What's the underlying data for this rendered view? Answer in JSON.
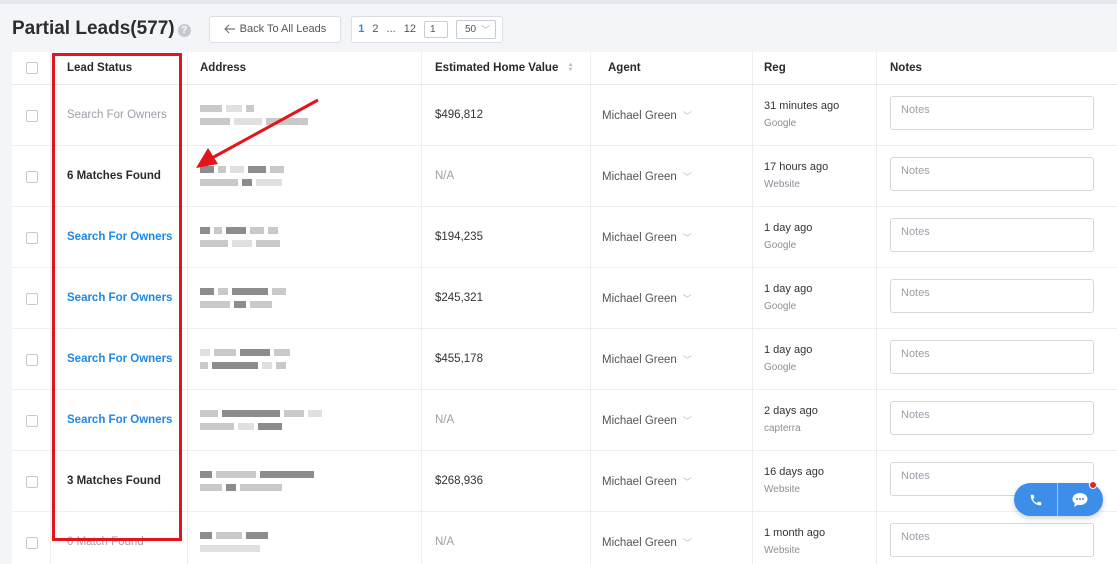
{
  "header": {
    "title": "Partial Leads(577)",
    "help_glyph": "?",
    "back_button": "Back To All Leads"
  },
  "pager": {
    "pages": [
      "1",
      "2",
      "...",
      "12"
    ],
    "current_page": "1",
    "per_page": "50"
  },
  "columns": {
    "lead_status": "Lead Status",
    "address": "Address",
    "estimated_home_value": "Estimated Home Value",
    "agent": "Agent",
    "reg": "Reg",
    "notes": "Notes"
  },
  "rows": [
    {
      "status": "Search For Owners",
      "status_style": "gray",
      "value": "$496,812",
      "agent": "Michael Green",
      "reg": "31 minutes ago",
      "source": "Google",
      "notes_placeholder": "Notes"
    },
    {
      "status": "6 Matches Found",
      "status_style": "dark",
      "value": "N/A",
      "agent": "Michael Green",
      "reg": "17 hours ago",
      "source": "Website",
      "notes_placeholder": "Notes"
    },
    {
      "status": "Search For Owners",
      "status_style": "blue",
      "value": "$194,235",
      "agent": "Michael Green",
      "reg": "1 day ago",
      "source": "Google",
      "notes_placeholder": "Notes"
    },
    {
      "status": "Search For Owners",
      "status_style": "blue",
      "value": "$245,321",
      "agent": "Michael Green",
      "reg": "1 day ago",
      "source": "Google",
      "notes_placeholder": "Notes"
    },
    {
      "status": "Search For Owners",
      "status_style": "blue",
      "value": "$455,178",
      "agent": "Michael Green",
      "reg": "1 day ago",
      "source": "Google",
      "notes_placeholder": "Notes"
    },
    {
      "status": "Search For Owners",
      "status_style": "blue",
      "value": "N/A",
      "agent": "Michael Green",
      "reg": "2 days ago",
      "source": "capterra",
      "notes_placeholder": "Notes"
    },
    {
      "status": "3 Matches Found",
      "status_style": "dark",
      "value": "$268,936",
      "agent": "Michael Green",
      "reg": "16 days ago",
      "source": "Website",
      "notes_placeholder": "Notes"
    },
    {
      "status": "0 Match Found",
      "status_style": "gray",
      "value": "N/A",
      "agent": "Michael Green",
      "reg": "1 month ago",
      "source": "Website",
      "notes_placeholder": "Notes"
    }
  ],
  "icons": {
    "back": "back-arrow-icon",
    "help": "help-icon",
    "sort": "sort-icon",
    "agent_dropdown": "chevron-down-icon",
    "phone": "phone-icon",
    "chat": "chat-bubble-icon"
  },
  "colors": {
    "accent_blue": "#1e88e5",
    "highlight_red": "#e3141b",
    "widget_blue": "#3d8ee8"
  }
}
